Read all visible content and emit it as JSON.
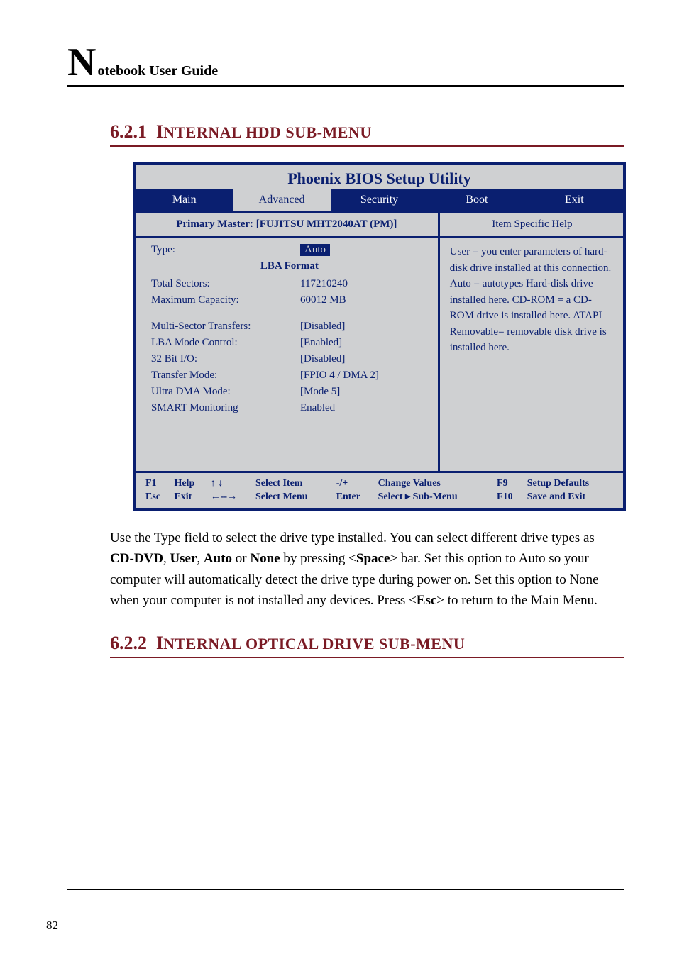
{
  "header": {
    "bigletter": "N",
    "rest": "otebook User Guide"
  },
  "sec1": {
    "num": "6.2.1",
    "title_pre": "I",
    "title_rest": "NTERNAL HDD SUB-MENU"
  },
  "bios": {
    "title": "Phoenix BIOS Setup Utility",
    "tabs": [
      "Main",
      "Advanced",
      "Security",
      "Boot",
      "Exit"
    ],
    "panel_header": "Primary Master: [FUJITSU MHT2040AT (PM)]",
    "help_header": "Item Specific Help",
    "type_label": "Type:",
    "type_value": "Auto",
    "lba": "LBA Format",
    "rows": [
      {
        "label": "Total Sectors:",
        "value": "117210240"
      },
      {
        "label": "Maximum Capacity:",
        "value": "60012 MB"
      }
    ],
    "rows2": [
      {
        "label": "Multi-Sector Transfers:",
        "value": "[Disabled]"
      },
      {
        "label": "LBA Mode Control:",
        "value": "[Enabled]"
      },
      {
        "label": "32 Bit I/O:",
        "value": "[Disabled]"
      },
      {
        "label": "Transfer Mode:",
        "value": "[FPIO 4 / DMA 2]"
      },
      {
        "label": "Ultra DMA Mode:",
        "value": "[Mode 5]"
      },
      {
        "label": "SMART Monitoring",
        "value": "Enabled"
      }
    ],
    "help_text": "User = you enter parameters of hard-disk drive installed at this connection. Auto = autotypes Hard-disk drive installed here. CD-ROM = a CD-ROM drive is installed here. ATAPI Removable= removable disk drive is installed here.",
    "footer": {
      "l1": {
        "k1": "F1",
        "v1": "Help",
        "arrows1": "↑ ↓",
        "v1b": "Select Item",
        "pm": "-/+",
        "cv": "Change Values",
        "k2": "F9",
        "v2": "Setup Defaults"
      },
      "l2": {
        "k1": "Esc",
        "v1": "Exit",
        "arrows2": "←--→",
        "v1b": "Select Menu",
        "en": "Enter",
        "sm": "Select ▸ Sub-Menu",
        "k2": "F10",
        "v2": "Save and Exit"
      }
    }
  },
  "body_paragraph_parts": {
    "p1": "Use the Type field to select the drive type installed. You can select different drive types as ",
    "b1": "CD-DVD",
    "c1": ", ",
    "b2": "User",
    "c2": ", ",
    "b3": "Auto",
    "c3": " or ",
    "b4": "None",
    "p2": " by pressing <",
    "b5": "Space",
    "p3": "> bar. Set this option to Auto so your computer will automatically detect the drive type during power on. Set this option to None when your computer is not installed any devices. Press <",
    "b6": "Esc",
    "p4": "> to return to the Main Menu."
  },
  "sec2": {
    "num": "6.2.2",
    "title_pre": "I",
    "title_rest": "NTERNAL OPTICAL DRIVE SUB-MENU"
  },
  "page_number": "82"
}
